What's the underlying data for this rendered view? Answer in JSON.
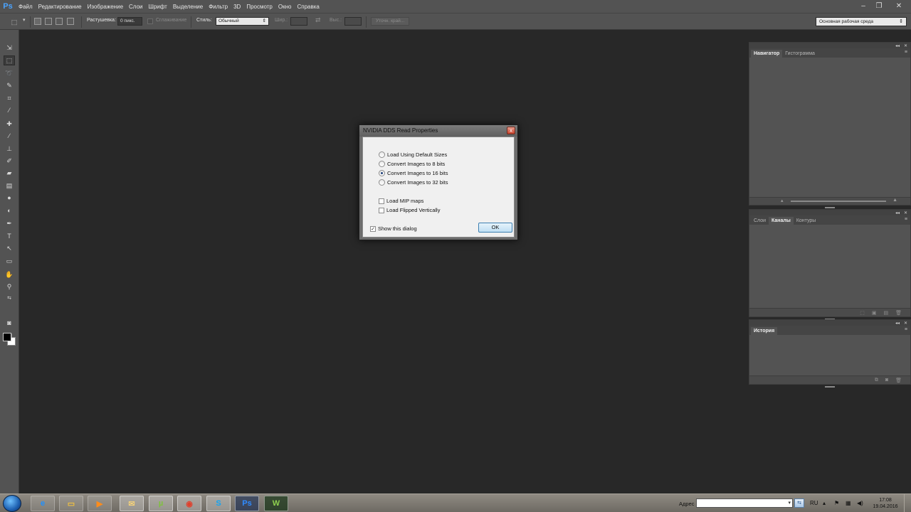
{
  "app": {
    "logo": "Ps"
  },
  "menu": [
    "Файл",
    "Редактирование",
    "Изображение",
    "Слои",
    "Шрифт",
    "Выделение",
    "Фильтр",
    "3D",
    "Просмотр",
    "Окно",
    "Справка"
  ],
  "window_buttons": {
    "minimize": "–",
    "maximize": "❐",
    "close": "✕"
  },
  "options_bar": {
    "feather_label": "Растушевка:",
    "feather_value": "0 пикс.",
    "antialias_label": "Сглаживание",
    "style_label": "Стиль:",
    "style_value": "Обычный",
    "width_label": "Шир.:",
    "height_label": "Выс.:",
    "refine_edge_label": "Уточн. край...",
    "workspace_value": "Основная рабочая среда"
  },
  "panels": {
    "navigator": {
      "tabs": [
        "Навигатор",
        "Гистограмма"
      ],
      "active": "Навигатор"
    },
    "channels": {
      "tabs": [
        "Слои",
        "Каналы",
        "Контуры"
      ],
      "active": "Каналы"
    },
    "history": {
      "tabs": [
        "История"
      ],
      "active": "История"
    }
  },
  "dialog": {
    "title": "NVIDIA DDS Read Properties",
    "close": "x",
    "options": [
      {
        "label": "Load Using Default Sizes",
        "selected": false
      },
      {
        "label": "Convert Images to 8 bits",
        "selected": false
      },
      {
        "label": "Convert Images to 16 bits",
        "selected": true
      },
      {
        "label": "Convert Images to 32 bits",
        "selected": false
      }
    ],
    "checks": [
      {
        "label": "Load MIP maps",
        "checked": false
      },
      {
        "label": "Load Flipped Vertically",
        "checked": false
      }
    ],
    "show_dialog": {
      "label": "Show this dialog",
      "checked": true
    },
    "ok_label": "OK"
  },
  "taskbar": {
    "apps": [
      {
        "name": "ie",
        "glyph": "e",
        "color": "#1e90ff"
      },
      {
        "name": "explorer",
        "glyph": "▭",
        "color": "#f0c040"
      },
      {
        "name": "media-player",
        "glyph": "▶",
        "color": "#ff8c1a"
      },
      {
        "name": "folder",
        "glyph": "✉",
        "color": "#f3d17a"
      },
      {
        "name": "utorrent",
        "glyph": "µ",
        "color": "#7ec23c"
      },
      {
        "name": "chrome",
        "glyph": "◉",
        "color": "#e0402c"
      },
      {
        "name": "skype",
        "glyph": "S",
        "color": "#12a5f4"
      },
      {
        "name": "photoshop",
        "glyph": "Ps",
        "color": "#2f8bff"
      },
      {
        "name": "app-w",
        "glyph": "W",
        "color": "#8fd14f"
      }
    ],
    "address_label": "Адрес",
    "language": "RU",
    "time": "17:08",
    "date": "19.04.2016"
  }
}
